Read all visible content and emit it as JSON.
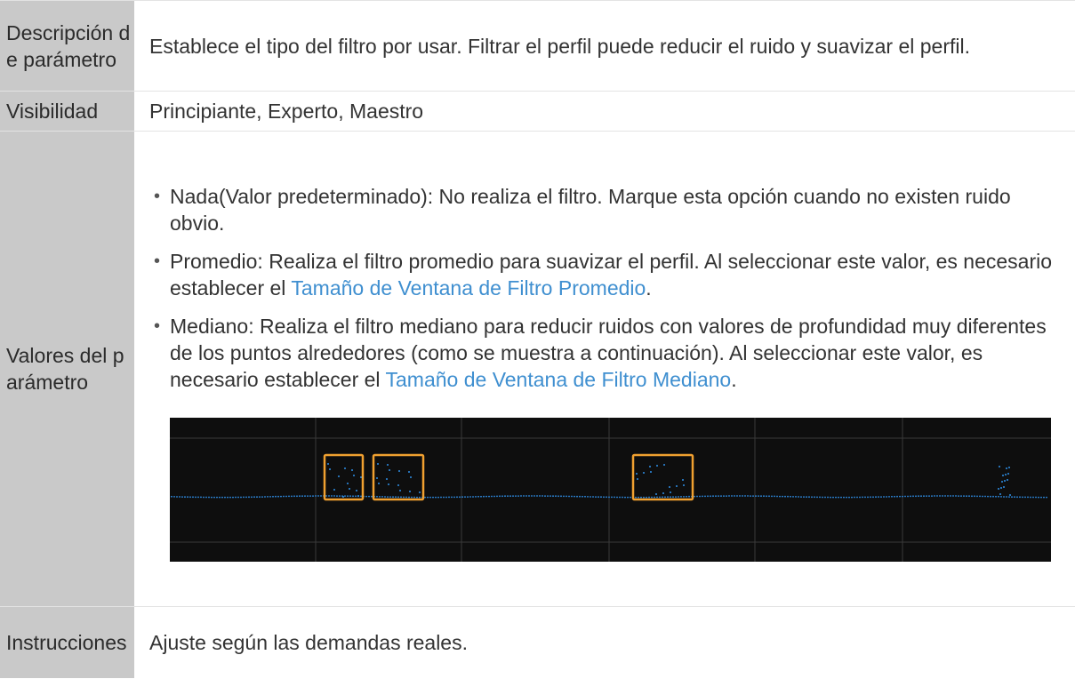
{
  "rows": {
    "description": {
      "label": "Descripción de parámetro",
      "text": "Establece el tipo del filtro por usar. Filtrar el perfil puede reducir el ruido y suavizar el perfil."
    },
    "visibility": {
      "label": "Visibilidad",
      "text": "Principiante, Experto, Maestro"
    },
    "values": {
      "label": "Valores del parámetro",
      "items": [
        {
          "text": "Nada(Valor predeterminado): No realiza el filtro. Marque esta opción cuando no existen ruido obvio."
        },
        {
          "text_before": "Promedio: Realiza el filtro promedio para suavizar el perfil. Al seleccionar este valor, es necesario establecer el ",
          "link": "Tamaño de Ventana de Filtro Promedio",
          "text_after": "."
        },
        {
          "text_before": "Mediano: Realiza el filtro mediano para reducir ruidos con valores de profundidad muy diferentes de los puntos alrededores (como se muestra a continuación). Al seleccionar este valor, es necesario establecer el ",
          "link": "Tamaño de Ventana de Filtro Mediano",
          "text_after": "."
        }
      ]
    },
    "instructions": {
      "label": "Instrucciones",
      "text": "Ajuste según las demandas reales."
    }
  },
  "colors": {
    "label_bg": "#c9c9c9",
    "link": "#3f8fd0",
    "figure_bg": "#0e0e0e",
    "profile_points": "#2f8fe8",
    "highlight_box": "#f0a030",
    "grid": "#3a3a3a"
  },
  "bullet_icon": "•"
}
